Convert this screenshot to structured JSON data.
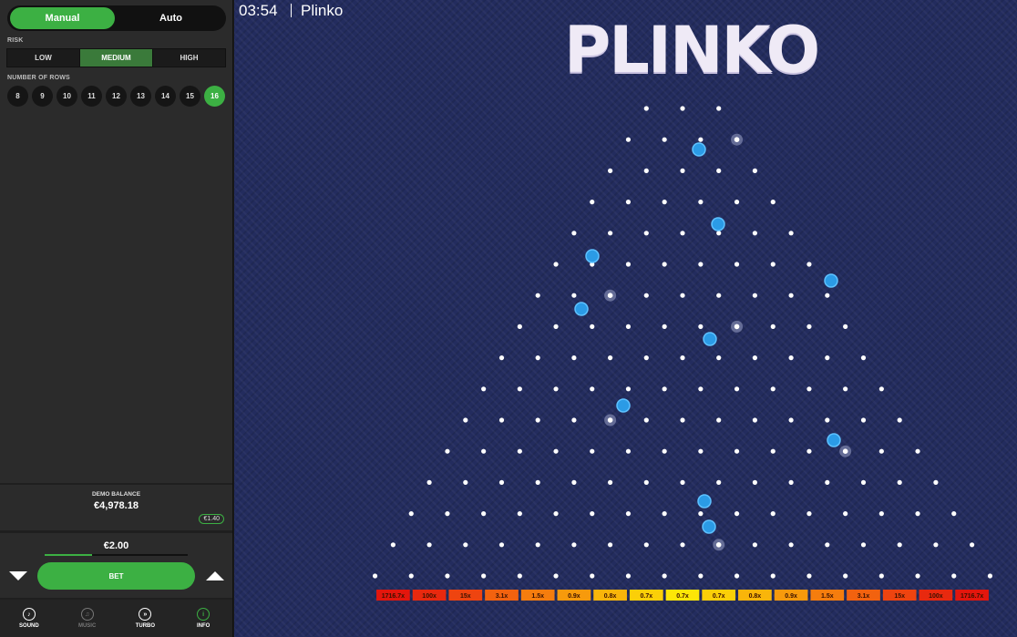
{
  "sidebar": {
    "mode": {
      "manual": "Manual",
      "auto": "Auto"
    },
    "risk_label": "RISK",
    "risk_options": [
      "LOW",
      "MEDIUM",
      "HIGH"
    ],
    "risk_selected": "MEDIUM",
    "rows_label": "NUMBER OF ROWS",
    "row_options": [
      "8",
      "9",
      "10",
      "11",
      "12",
      "13",
      "14",
      "15",
      "16"
    ],
    "rows_selected": "16",
    "balance_label": "DEMO BALANCE",
    "balance_value": "€4,978.18",
    "last_win": "€1.40",
    "bet_amount": "€2.00",
    "bet_slider_fraction": 0.33,
    "bet_label": "BET",
    "footer": [
      {
        "label": "SOUND",
        "icon": "sound-icon",
        "glyph": "♪",
        "state": "on-white"
      },
      {
        "label": "MUSIC",
        "icon": "music-icon",
        "glyph": "♫",
        "state": "dim"
      },
      {
        "label": "TURBO",
        "icon": "turbo-icon",
        "glyph": "»",
        "state": "on-white"
      },
      {
        "label": "INFO",
        "icon": "info-icon",
        "glyph": "i",
        "state": "on"
      }
    ]
  },
  "game": {
    "clock": "03:54",
    "title": "Plinko",
    "logo": "PLINKO",
    "rows": 16,
    "multipliers": [
      "1716.7x",
      "100x",
      "15x",
      "3.1x",
      "1.5x",
      "0.9x",
      "0.8x",
      "0.7x",
      "0.7x",
      "0.7x",
      "0.8x",
      "0.9x",
      "1.5x",
      "3.1x",
      "15x",
      "100x",
      "1716.7x"
    ],
    "multiplier_colors": [
      "#e3160d",
      "#e8290f",
      "#ee4410",
      "#f2620f",
      "#f57d0e",
      "#f79a0c",
      "#f9b50a",
      "#fbcf08",
      "#fde607",
      "#fbcf08",
      "#f9b50a",
      "#f79a0c",
      "#f57d0e",
      "#f2620f",
      "#ee4410",
      "#e8290f",
      "#e3160d"
    ],
    "colors": {
      "peg": "#ffffff",
      "ball": "#2b9be6",
      "ball_edge": "#5ec1ff",
      "hit_glow": "#9aa3c7"
    }
  }
}
